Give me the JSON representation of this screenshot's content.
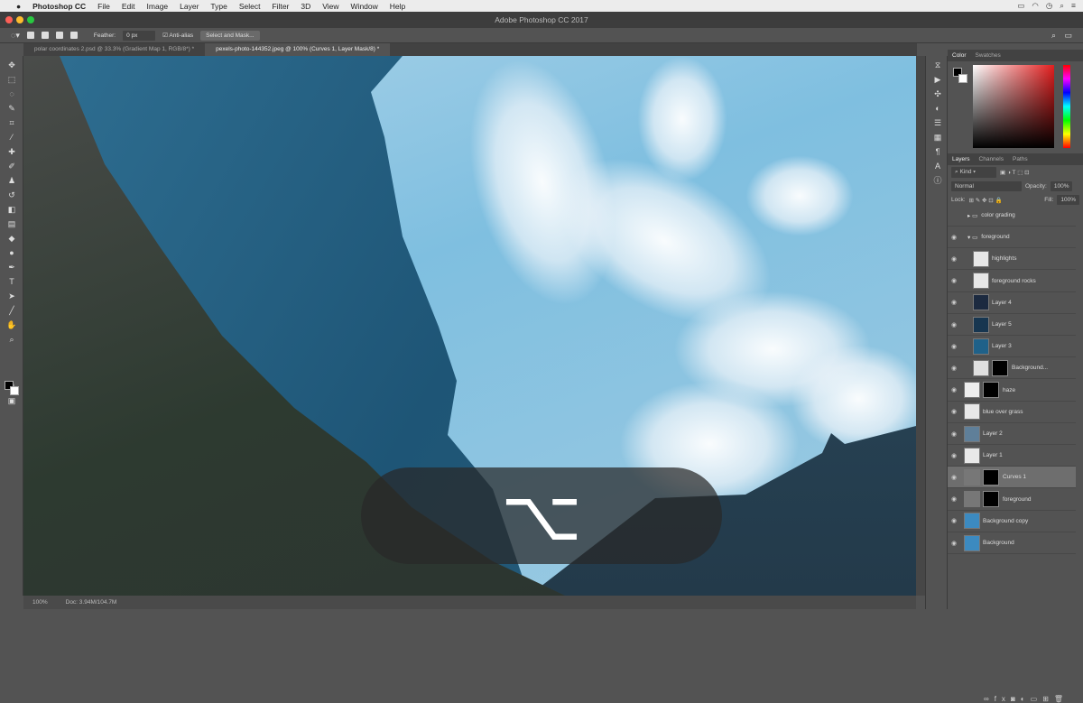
{
  "menubar": {
    "app": "Photoshop CC",
    "items": [
      "File",
      "Edit",
      "Image",
      "Layer",
      "Type",
      "Select",
      "Filter",
      "3D",
      "View",
      "Window",
      "Help"
    ],
    "status_icons": [
      "battery-icon",
      "wifi-icon",
      "clock-icon",
      "search-icon",
      "list-icon"
    ]
  },
  "window": {
    "title": "Adobe Photoshop CC 2017"
  },
  "options": {
    "feather_label": "Feather:",
    "feather_value": "0 px",
    "antialias_label": "Anti-alias",
    "select_mask": "Select and Mask..."
  },
  "tabs": [
    {
      "label": "polar coordinates 2.psd @ 33.3% (Gradient Map 1, RGB/8*) *"
    },
    {
      "label": "pexels-photo-144352.jpeg @ 100% (Curves 1, Layer Mask/8) *"
    }
  ],
  "overlay": {
    "key_symbol": "⌥"
  },
  "status": {
    "zoom": "100%",
    "doc": "Doc: 3.94M/104.7M"
  },
  "color_panel": {
    "tabs": [
      "Color",
      "Swatches"
    ]
  },
  "layers_panel": {
    "tabs": [
      "Layers",
      "Channels",
      "Paths"
    ],
    "filter": "Kind",
    "blend_mode": "Normal",
    "opacity_label": "Opacity:",
    "opacity": "100%",
    "lock_label": "Lock:",
    "fill_label": "Fill:",
    "fill": "100%",
    "layers": [
      {
        "name": "color grading",
        "type": "group"
      },
      {
        "name": "foreground",
        "type": "group"
      },
      {
        "name": "highlights",
        "thumb": "#e8e8e8"
      },
      {
        "name": "foreground rocks",
        "thumb": "#e8e8e8"
      },
      {
        "name": "Layer 4",
        "thumb": "#1c2a40"
      },
      {
        "name": "Layer 5",
        "thumb": "#173650"
      },
      {
        "name": "Layer 3",
        "thumb": "#1f6189"
      },
      {
        "name": "Background...",
        "thumb": "#e0e0e0",
        "mask": true
      },
      {
        "name": "haze",
        "thumb": "#eeeeee",
        "mask": true
      },
      {
        "name": "blue over grass",
        "thumb": "#e8e8e8"
      },
      {
        "name": "Layer 2",
        "thumb": "#5f7f99"
      },
      {
        "name": "Layer 1",
        "thumb": "#e8e8e8"
      },
      {
        "name": "Curves 1",
        "thumb": "#777777",
        "mask": true,
        "selected": true
      },
      {
        "name": "foreground",
        "thumb": "#777777",
        "mask": true
      },
      {
        "name": "Background copy",
        "thumb": "#3c8ac0"
      },
      {
        "name": "Background",
        "thumb": "#3c8ac0"
      }
    ]
  }
}
